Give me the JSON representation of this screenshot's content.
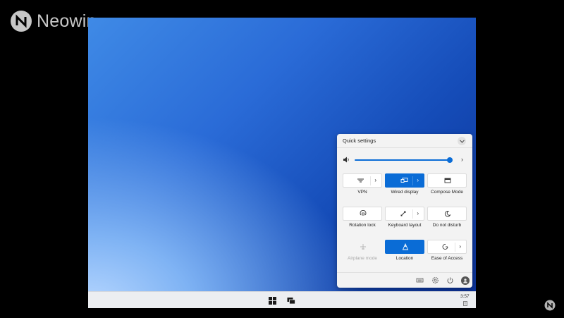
{
  "watermark": {
    "brand": "Neowin"
  },
  "quick_settings": {
    "title": "Quick settings",
    "volume": {
      "level": 0.97
    },
    "tiles": [
      {
        "label": "VPN",
        "icon": "vpn-icon",
        "active": false,
        "has_arrow": true,
        "disabled": false
      },
      {
        "label": "Wired display",
        "icon": "wired-display-icon",
        "active": true,
        "has_arrow": true,
        "disabled": false
      },
      {
        "label": "Compose Mode",
        "icon": "compose-mode-icon",
        "active": false,
        "has_arrow": false,
        "disabled": false
      },
      {
        "label": "Rotation lock",
        "icon": "rotation-lock-icon",
        "active": false,
        "has_arrow": false,
        "disabled": false
      },
      {
        "label": "Keyboard layout",
        "icon": "keyboard-layout-icon",
        "active": false,
        "has_arrow": true,
        "disabled": false
      },
      {
        "label": "Do not disturb",
        "icon": "moon-icon",
        "active": false,
        "has_arrow": false,
        "disabled": false
      },
      {
        "label": "Airplane mode",
        "icon": "airplane-icon",
        "active": false,
        "has_arrow": false,
        "disabled": true
      },
      {
        "label": "Location",
        "icon": "location-icon",
        "active": true,
        "has_arrow": false,
        "disabled": false
      },
      {
        "label": "Ease of Access",
        "icon": "ease-of-access-icon",
        "active": false,
        "has_arrow": true,
        "disabled": false
      }
    ],
    "footer_icons": [
      "keyboard-icon",
      "settings-icon",
      "power-icon",
      "user-avatar-icon"
    ]
  },
  "taskbar": {
    "time": "3:57"
  },
  "colors": {
    "accent": "#0a6cd6",
    "panel": "#f3f3f3",
    "taskbar": "#eceef1"
  }
}
